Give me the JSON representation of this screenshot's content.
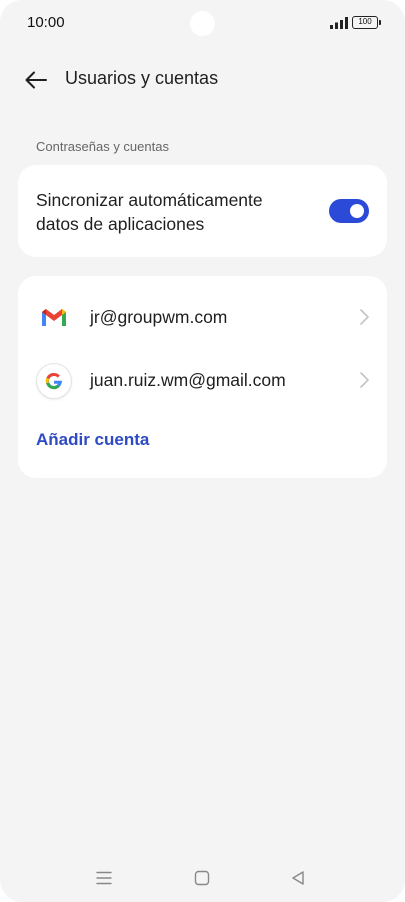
{
  "status_bar": {
    "time": "10:00",
    "battery": "100",
    "icons": [
      "signal-icon",
      "battery-icon"
    ]
  },
  "header": {
    "title": "Usuarios y cuentas",
    "back_icon": "arrow-left-icon"
  },
  "passwords_section": {
    "header": "Contraseñas y cuentas",
    "sync_label": "Sincronizar automáticamente datos de aplicaciones",
    "sync_enabled": true
  },
  "accounts": {
    "items": [
      {
        "email": "jr@groupwm.com",
        "icon": "gmail-icon"
      },
      {
        "email": "juan.ruiz.wm@gmail.com",
        "icon": "google-icon"
      }
    ],
    "add_label": "Añadir cuenta"
  },
  "nav_bar": {
    "icons": [
      "menu-icon",
      "home-icon",
      "back-triangle-icon"
    ]
  },
  "colors": {
    "accent": "#2b4ad8",
    "link": "#2f4bc4",
    "background": "#f4f4f4",
    "card": "#ffffff"
  }
}
